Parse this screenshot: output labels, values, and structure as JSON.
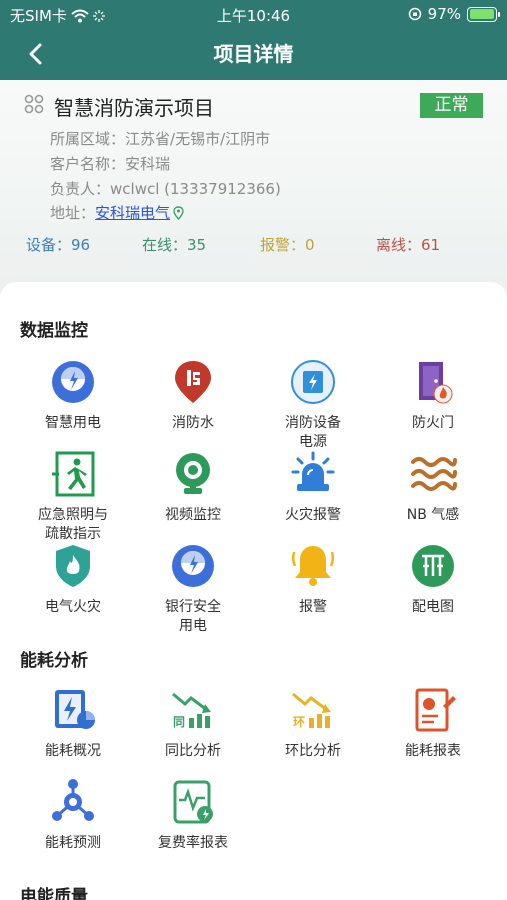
{
  "status_bar": {
    "carrier": "无SIM卡",
    "time": "上午10:46",
    "battery": "97%",
    "battery_level": 0.97
  },
  "nav": {
    "title": "项目详情"
  },
  "project": {
    "name": "智慧消防演示项目",
    "status": "正常",
    "region_label": "所属区域：",
    "region": "江苏省/无锡市/江阴市",
    "client_label": "客户名称：",
    "client": "安科瑞",
    "owner_label": "负责人：",
    "owner": "wclwcl (13337912366)",
    "address_label": "地址：",
    "address": "安科瑞电气"
  },
  "stats": {
    "devices": "设备：96",
    "online": "在线：35",
    "alarm": "报警：0",
    "offline": "离线：61"
  },
  "sections": {
    "data_monitor": {
      "title": "数据监控",
      "items": [
        {
          "label": "智慧用电",
          "icon": "smart-power-icon"
        },
        {
          "label": "消防水",
          "icon": "fire-water-icon"
        },
        {
          "label": "消防设备\n电源",
          "icon": "fire-equipment-power-icon"
        },
        {
          "label": "防火门",
          "icon": "fire-door-icon"
        },
        {
          "label": "应急照明与\n疏散指示",
          "icon": "emergency-exit-icon"
        },
        {
          "label": "视频监控",
          "icon": "video-camera-icon"
        },
        {
          "label": "火灾报警",
          "icon": "fire-alarm-icon"
        },
        {
          "label": "NB 气感",
          "icon": "gas-sensor-icon"
        },
        {
          "label": "电气火灾",
          "icon": "electrical-fire-icon"
        },
        {
          "label": "银行安全\n用电",
          "icon": "bank-power-icon"
        },
        {
          "label": "报警",
          "icon": "alarm-bell-icon"
        },
        {
          "label": "配电图",
          "icon": "distribution-diagram-icon"
        }
      ]
    },
    "energy": {
      "title": "能耗分析",
      "items": [
        {
          "label": "能耗概况",
          "icon": "energy-overview-icon"
        },
        {
          "label": "同比分析",
          "icon": "yoy-analysis-icon"
        },
        {
          "label": "环比分析",
          "icon": "mom-analysis-icon"
        },
        {
          "label": "能耗报表",
          "icon": "energy-report-icon"
        },
        {
          "label": "能耗预测",
          "icon": "energy-forecast-icon"
        },
        {
          "label": "复费率报表",
          "icon": "multi-rate-report-icon"
        }
      ]
    },
    "power_quality": {
      "title": "电能质量"
    }
  },
  "colors": {
    "header": "#2e7a72",
    "status_ok": "#3daa5a",
    "devices": "#3b7fb5",
    "online": "#3a9070",
    "alarm": "#c2a13b",
    "offline": "#c0504a"
  }
}
